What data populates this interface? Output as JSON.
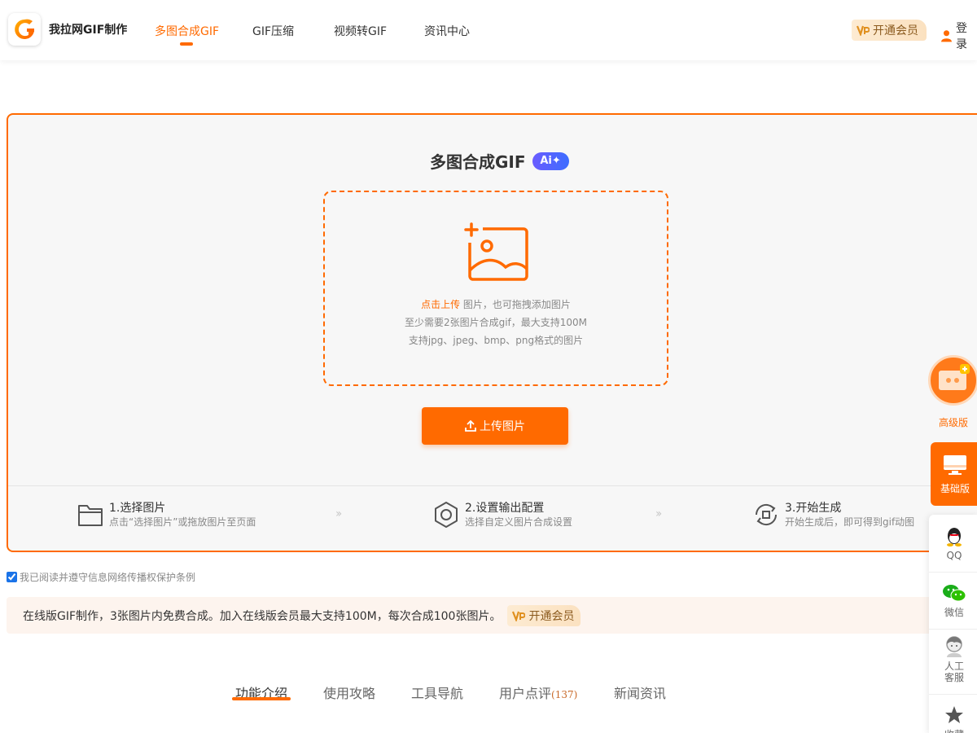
{
  "header": {
    "brand": "我拉网GIF制作",
    "nav": [
      "多图合成GIF",
      "GIF压缩",
      "视频转GIF",
      "资讯中心"
    ],
    "vip_label": "开通会员",
    "login_label": "登录"
  },
  "panel": {
    "title": "多图合成GIF",
    "ai_badge": "Ai✦",
    "dz_click": "点击上传",
    "dz_line1_rest": " 图片，也可拖拽添加图片",
    "dz_line2": "至少需要2张图片合成gif，最大支持100M",
    "dz_line3": "支持jpg、jpeg、bmp、png格式的图片",
    "upload_button": "上传图片",
    "steps": [
      {
        "title": "1.选择图片",
        "desc": "点击“选择图片”或拖放图片至页面"
      },
      {
        "title": "2.设置输出配置",
        "desc": "选择自定义图片合成设置"
      },
      {
        "title": "3.开始生成",
        "desc": "开始生成后，即可得到gif动图"
      }
    ],
    "step_arrow": "››"
  },
  "agreement": "我已阅读并遵守信息网络传播权保护条例",
  "promo": {
    "text": "在线版GIF制作，3张图片内免费合成。加入在线版会员最大支持100M，每次合成100张图片。",
    "vip_label": "开通会员"
  },
  "tabs": [
    {
      "label": "功能介绍"
    },
    {
      "label": "使用攻略"
    },
    {
      "label": "工具导航"
    },
    {
      "label": "用户点评",
      "count": "(137)"
    },
    {
      "label": "新闻资讯"
    }
  ],
  "side": {
    "advanced_label": "高级版",
    "basic_label": "基础版",
    "qq_label": "QQ",
    "wechat_label": "微信",
    "service_label": "人工客服",
    "service_line1": "人工",
    "service_line2": "客服",
    "favorite_label": "收藏"
  },
  "colors": {
    "accent": "#ff6a00",
    "panel_bg": "#f7f7f7",
    "promo_bg": "#fdf4ee",
    "ai_badge": "#5a63ff"
  },
  "agreement_checked": true
}
